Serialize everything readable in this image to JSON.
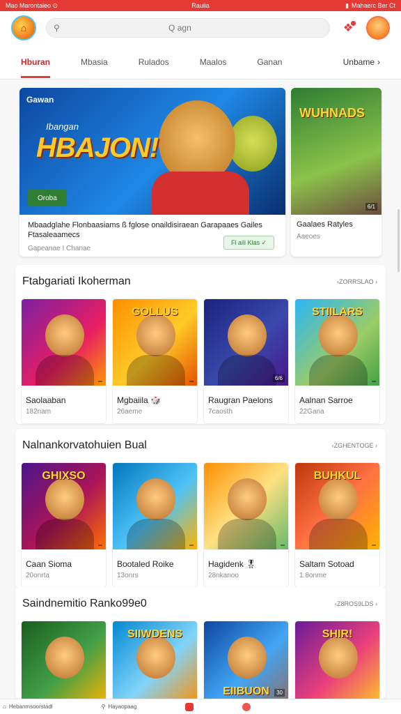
{
  "status": {
    "left": "Mao Marontaieo ⊙",
    "center": "Rauiia",
    "right": "Mahaerc Ber Ct"
  },
  "search": {
    "placeholder": "Q agn"
  },
  "tabs": {
    "items": [
      "Hburan",
      "Mbasia",
      "Rulados",
      "Maalos",
      "Ganan"
    ],
    "more": "Unbame",
    "active_index": 0
  },
  "feature": {
    "tag": "Gawan",
    "subtitle": "Ibangan",
    "title": "HBAJON!",
    "button": "Oroba",
    "desc": "Mbaadglahe Flonbaasiams ß fglose onaildisiraean Garapaaes Gailes Ftasaleaamecs",
    "meta": "Gapeanae I Chanae",
    "pill": "Fl aili Klas ✓"
  },
  "side": {
    "title": "WUHNADS",
    "num": "6/1",
    "name": "Gaalaes Ratyles",
    "meta": "Aaeoes"
  },
  "sections": [
    {
      "title": "Ftabgariati Ikoherman",
      "more": "‹ZORRSLAO ›",
      "cards": [
        {
          "name": "Saolaaban",
          "sub": "182nam",
          "label": "",
          "num": ""
        },
        {
          "name": "Mgbaiila 🎲",
          "sub": "26aeme",
          "label": "GOLLUS",
          "num": ""
        },
        {
          "name": "Raugran Paelons",
          "sub": "7caosth",
          "label": "",
          "num": "6/6"
        },
        {
          "name": "Aalnan Sarroe",
          "sub": "22Gana",
          "label": "STIILARS",
          "num": ""
        }
      ]
    },
    {
      "title": "Nalnankorvatohuien Bual",
      "more": "‹ZGHENTOGE ›",
      "cards": [
        {
          "name": "Caan Sioma",
          "sub": "20onrta",
          "label": "GHIXSO",
          "num": ""
        },
        {
          "name": "Bootaled Roike",
          "sub": "13onrs",
          "label": "",
          "num": ""
        },
        {
          "name": "Hagidenk 🎖",
          "sub": "28nkanoo",
          "label": "",
          "num": ""
        },
        {
          "name": "Saltam Sotoad",
          "sub": "1.8onme",
          "label": "BUHKUL",
          "num": ""
        }
      ]
    },
    {
      "title": "Saindnemitio Ranko99e0",
      "more": "‹Z8ROS9LDS ›",
      "cards": [
        {
          "name": "",
          "sub": "",
          "label": "",
          "num": ""
        },
        {
          "name": "",
          "sub": "",
          "label": "SIIWDENS",
          "num": ""
        },
        {
          "name": "",
          "sub": "",
          "label": "EIIBUON",
          "num": "30"
        },
        {
          "name": "",
          "sub": "",
          "label": "SHIR!",
          "num": ""
        }
      ]
    }
  ],
  "bottom": {
    "item1": "Hebanmsoorstadl",
    "item2": "Hayaopaag",
    "item3": "",
    "item4": ""
  },
  "colors": {
    "accent": "#e53935",
    "cta_green": "#2e7d32"
  }
}
